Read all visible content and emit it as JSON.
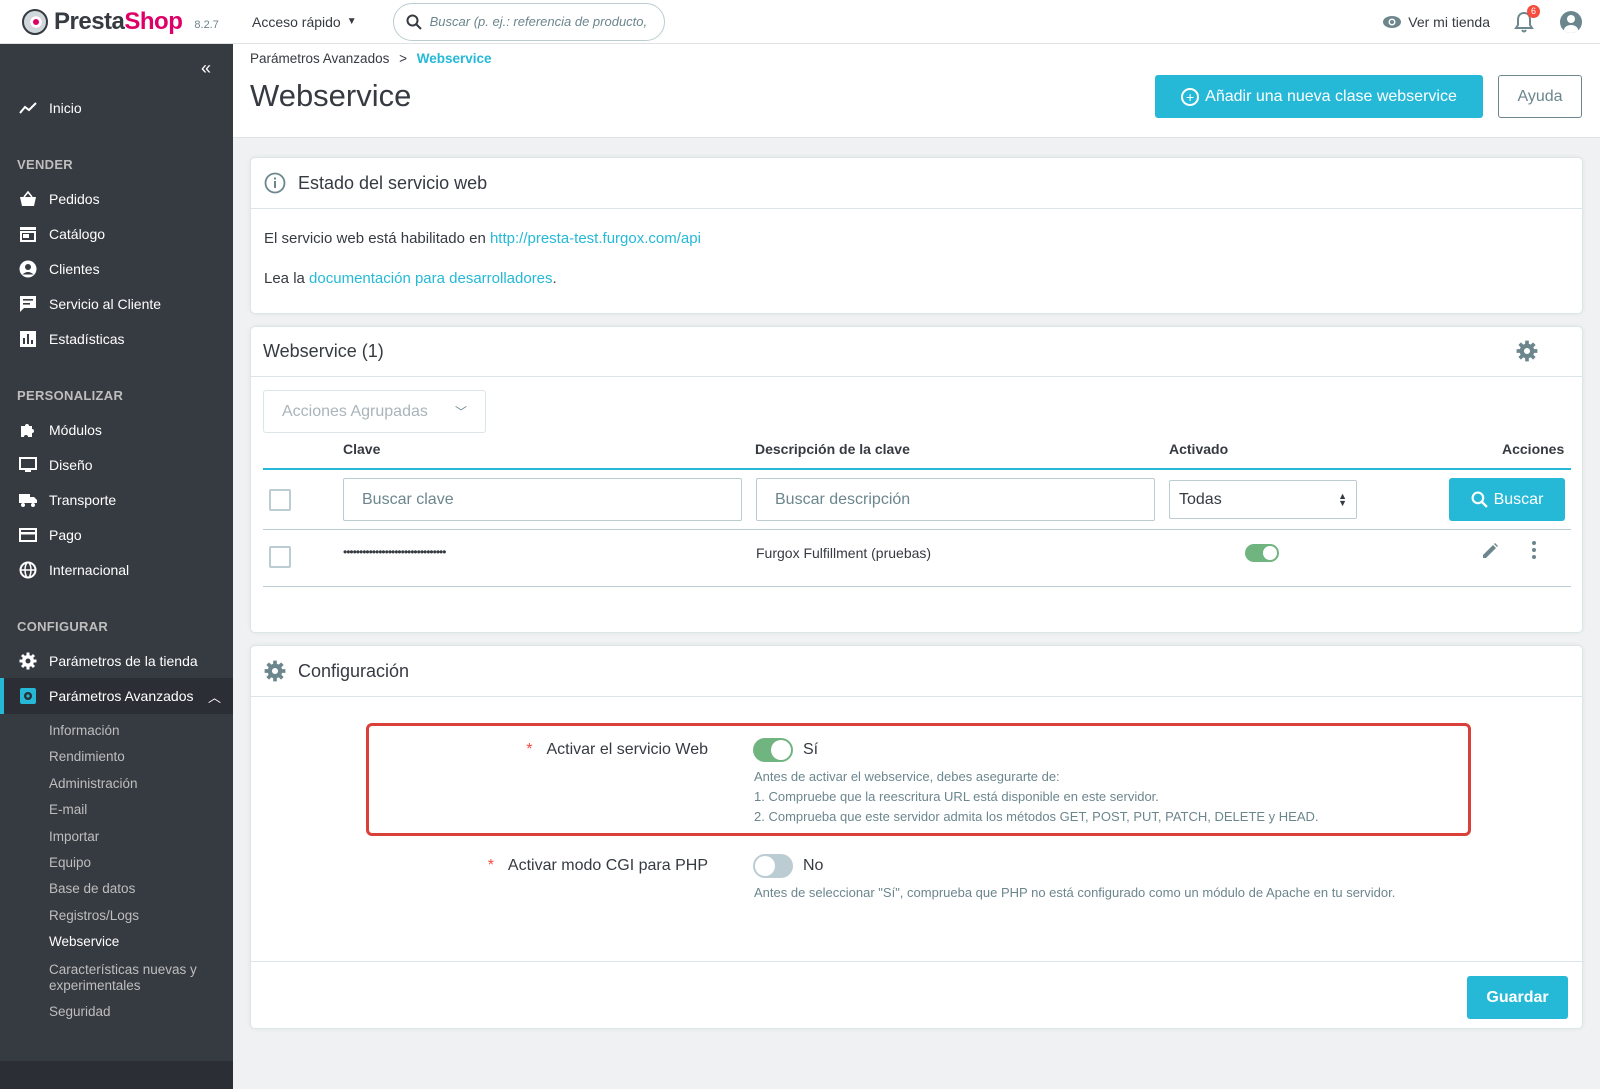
{
  "topbar": {
    "brand_part1": "Presta",
    "brand_part2": "Shop",
    "version": "8.2.7",
    "quick_access": "Acceso rápido",
    "search_placeholder": "Buscar (p. ej.: referencia de producto,",
    "view_store": "Ver mi tienda",
    "notifications_count": "6"
  },
  "sidebar": {
    "home": "Inicio",
    "sections": [
      {
        "title": "VENDER",
        "items": [
          "Pedidos",
          "Catálogo",
          "Clientes",
          "Servicio al Cliente",
          "Estadísticas"
        ]
      },
      {
        "title": "PERSONALIZAR",
        "items": [
          "Módulos",
          "Diseño",
          "Transporte",
          "Pago",
          "Internacional"
        ]
      },
      {
        "title": "CONFIGURAR",
        "items": [
          "Parámetros de la tienda",
          "Parámetros Avanzados"
        ]
      }
    ],
    "submenu": [
      "Información",
      "Rendimiento",
      "Administración",
      "E-mail",
      "Importar",
      "Equipo",
      "Base de datos",
      "Registros/Logs",
      "Webservice",
      "Características nuevas y experimentales",
      "Seguridad"
    ]
  },
  "header": {
    "breadcrumb_parent": "Parámetros Avanzados",
    "breadcrumb_sep": ">",
    "breadcrumb_current": "Webservice",
    "title": "Webservice",
    "add_button": "Añadir una nueva clase webservice",
    "help_button": "Ayuda"
  },
  "status_card": {
    "title": "Estado del servicio web",
    "line1_text": "El servicio web está habilitado en ",
    "line1_link": "http://presta-test.furgox.com/api",
    "line2_text": "Lea la ",
    "line2_link": "documentación para desarrolladores",
    "line2_end": "."
  },
  "list_card": {
    "title": "Webservice (1)",
    "bulk_actions": "Acciones Agrupadas",
    "columns": {
      "key": "Clave",
      "description": "Descripción de la clave",
      "enabled": "Activado",
      "actions": "Acciones"
    },
    "filters": {
      "key_placeholder": "Buscar clave",
      "description_placeholder": "Buscar descripción",
      "enabled_value": "Todas",
      "search_button": "Buscar"
    },
    "rows": [
      {
        "key": "••••••••••••••••••••••••••••••••",
        "description": "Furgox Fulfillment (pruebas)",
        "enabled": true
      }
    ]
  },
  "config_card": {
    "title": "Configuración",
    "fields": [
      {
        "label": "Activar el servicio Web",
        "required": "*",
        "value": "Sí",
        "enabled": true,
        "help": [
          "Antes de activar el webservice, debes asegurarte de:",
          "1. Compruebe que la reescritura URL está disponible en este servidor.",
          "2. Comprueba que este servidor admita los métodos GET, POST, PUT, PATCH, DELETE y HEAD."
        ]
      },
      {
        "label": "Activar modo CGI para PHP",
        "required": "*",
        "value": "No",
        "enabled": false,
        "help": [
          "Antes de seleccionar \"Sí\", comprueba que PHP no está configurado como un módulo de Apache en tu servidor."
        ]
      }
    ],
    "save_button": "Guardar"
  },
  "colors": {
    "accent": "#25b9d7",
    "sidebar_bg": "#363a41",
    "toggle_on": "#70b580",
    "highlight": "#d9403a"
  }
}
